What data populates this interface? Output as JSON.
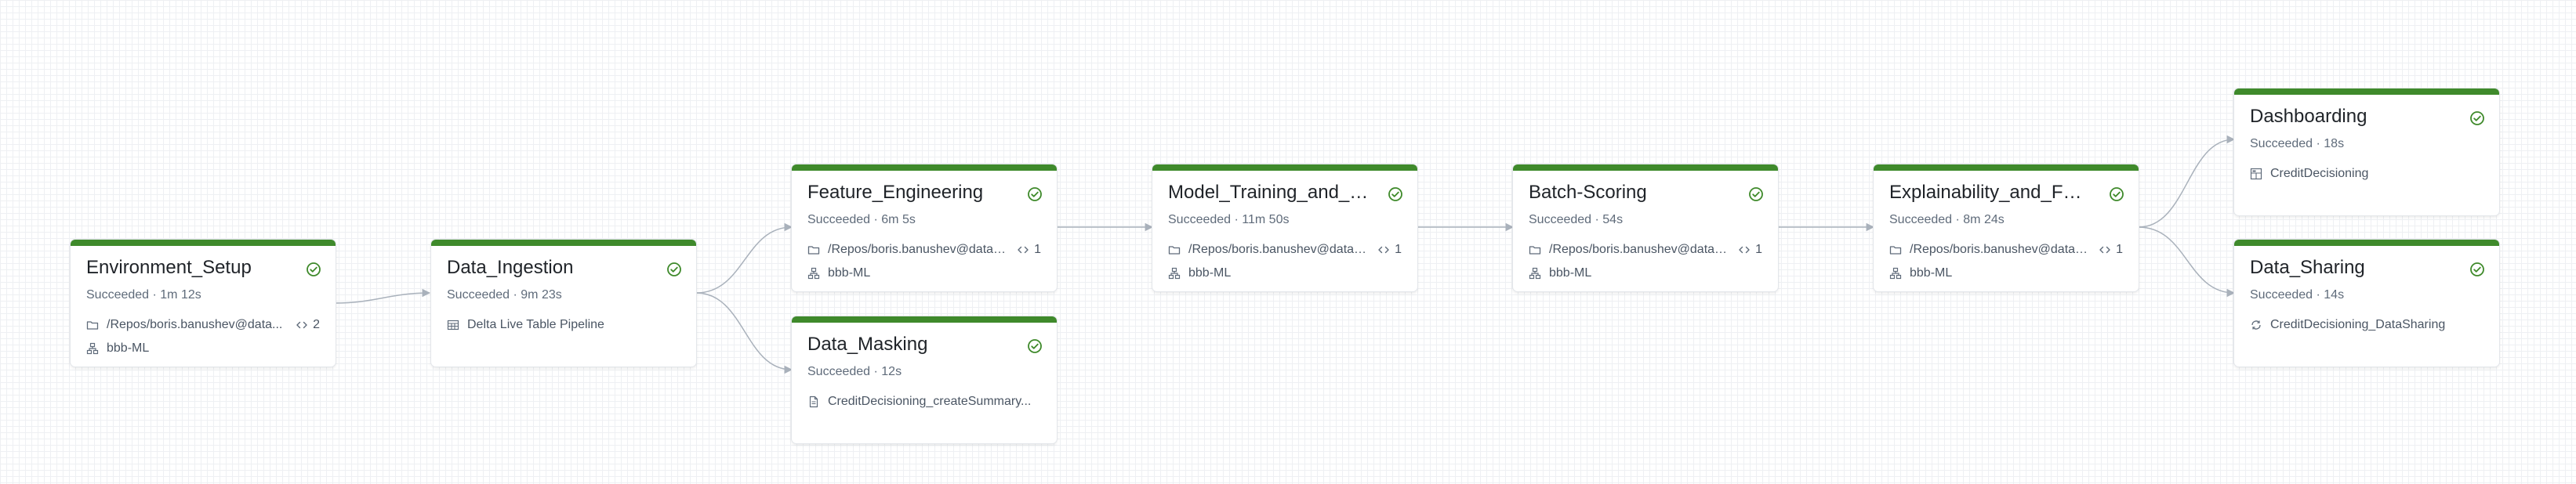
{
  "colors": {
    "success": "#3f8a2b",
    "edge": "#a9b1bb"
  },
  "tasks": [
    {
      "title": "Environment_Setup",
      "status": "Succeeded · 1m 12s",
      "status_icon": "check-circle-icon",
      "row1": {
        "icon": "folder-icon",
        "text": "/Repos/boris.banushev@data...",
        "params_icon": "code-icon",
        "params": "2"
      },
      "row2": {
        "icon": "cluster-icon",
        "text": "bbb-ML"
      }
    },
    {
      "title": "Data_Ingestion",
      "status": "Succeeded · 9m 23s",
      "status_icon": "check-circle-icon",
      "row1": {
        "icon": "table-icon",
        "text": "Delta Live Table Pipeline"
      }
    },
    {
      "title": "Feature_Engineering",
      "status": "Succeeded · 6m 5s",
      "status_icon": "check-circle-icon",
      "row1": {
        "icon": "folder-icon",
        "text": "/Repos/boris.banushev@datab...",
        "params_icon": "code-icon",
        "params": "1"
      },
      "row2": {
        "icon": "cluster-icon",
        "text": "bbb-ML"
      }
    },
    {
      "title": "Data_Masking",
      "status": "Succeeded · 12s",
      "status_icon": "check-circle-icon",
      "row1": {
        "icon": "file-icon",
        "text": "CreditDecisioning_createSummary..."
      }
    },
    {
      "title": "Model_Training_and_De...",
      "status": "Succeeded · 11m 50s",
      "status_icon": "check-circle-icon",
      "row1": {
        "icon": "folder-icon",
        "text": "/Repos/boris.banushev@datab...",
        "params_icon": "code-icon",
        "params": "1"
      },
      "row2": {
        "icon": "cluster-icon",
        "text": "bbb-ML"
      }
    },
    {
      "title": "Batch-Scoring",
      "status": "Succeeded · 54s",
      "status_icon": "check-circle-icon",
      "row1": {
        "icon": "folder-icon",
        "text": "/Repos/boris.banushev@datab...",
        "params_icon": "code-icon",
        "params": "1"
      },
      "row2": {
        "icon": "cluster-icon",
        "text": "bbb-ML"
      }
    },
    {
      "title": "Explainability_and_Fairn...",
      "status": "Succeeded · 8m 24s",
      "status_icon": "check-circle-icon",
      "row1": {
        "icon": "folder-icon",
        "text": "/Repos/boris.banushev@datab...",
        "params_icon": "code-icon",
        "params": "1"
      },
      "row2": {
        "icon": "cluster-icon",
        "text": "bbb-ML"
      }
    },
    {
      "title": "Dashboarding",
      "status": "Succeeded · 18s",
      "status_icon": "check-circle-icon",
      "row1": {
        "icon": "dashboard-icon",
        "text": "CreditDecisioning"
      }
    },
    {
      "title": "Data_Sharing",
      "status": "Succeeded · 14s",
      "status_icon": "check-circle-icon",
      "row1": {
        "icon": "share-icon",
        "text": "CreditDecisioning_DataSharing"
      }
    }
  ]
}
